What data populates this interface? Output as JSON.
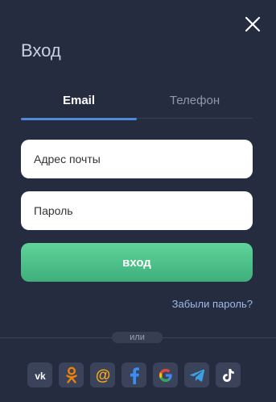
{
  "header": {
    "title": "Вход"
  },
  "tabs": [
    {
      "label": "Email",
      "active": true
    },
    {
      "label": "Телефон",
      "active": false
    }
  ],
  "form": {
    "email_placeholder": "Адрес почты",
    "password_placeholder": "Пароль",
    "submit_label": "вход",
    "forgot_label": "Забыли пароль?"
  },
  "divider_label": "или",
  "socials": [
    {
      "icon": "vk-icon"
    },
    {
      "icon": "odnoklassniki-icon"
    },
    {
      "icon": "mail-ru-icon"
    },
    {
      "icon": "facebook-icon"
    },
    {
      "icon": "google-icon"
    },
    {
      "icon": "telegram-icon"
    },
    {
      "icon": "tiktok-icon"
    }
  ],
  "colors": {
    "background": "#252c40",
    "accent_tab": "#4d8ad8",
    "submit_green": "#4cc48b",
    "link": "#9db9e6"
  }
}
